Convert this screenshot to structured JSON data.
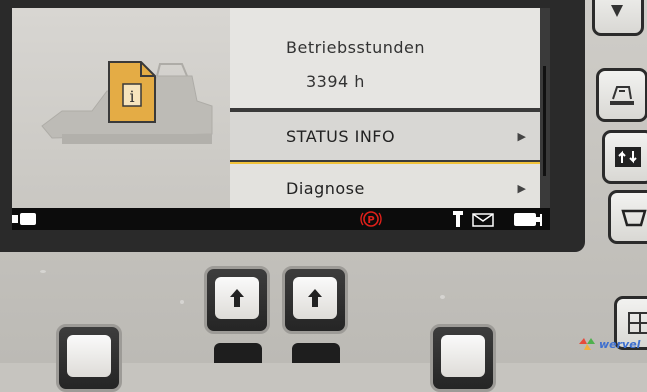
{
  "screen": {
    "hours": {
      "title": "Betriebsstunden",
      "value": "3394 h"
    },
    "menu": [
      {
        "label": "STATUS INFO",
        "arrow": "▶"
      },
      {
        "label": "Diagnose",
        "arrow": "▶",
        "selected": true
      }
    ],
    "status_bar": {
      "parking_brake_icon": "parking-brake-icon",
      "parking_brake_color": "#e0201a",
      "icons": [
        "connector-icon",
        "parking-brake-icon",
        "tool-icon",
        "mail-icon",
        "battery-icon"
      ]
    },
    "left_graphic": {
      "icons": [
        "paver-machine-icon",
        "info-document-icon"
      ],
      "info_icon_color": "#e4ac45"
    }
  },
  "side_buttons": [
    "arrow-down-icon",
    "screed-icon",
    "swap-icon",
    "hopper-icon"
  ],
  "bottom_buttons": [
    "arrow-up-icon",
    "arrow-up-icon",
    "blank-key",
    "blank-key"
  ],
  "accent_color": "#f0c23a",
  "watermark": "wervel"
}
